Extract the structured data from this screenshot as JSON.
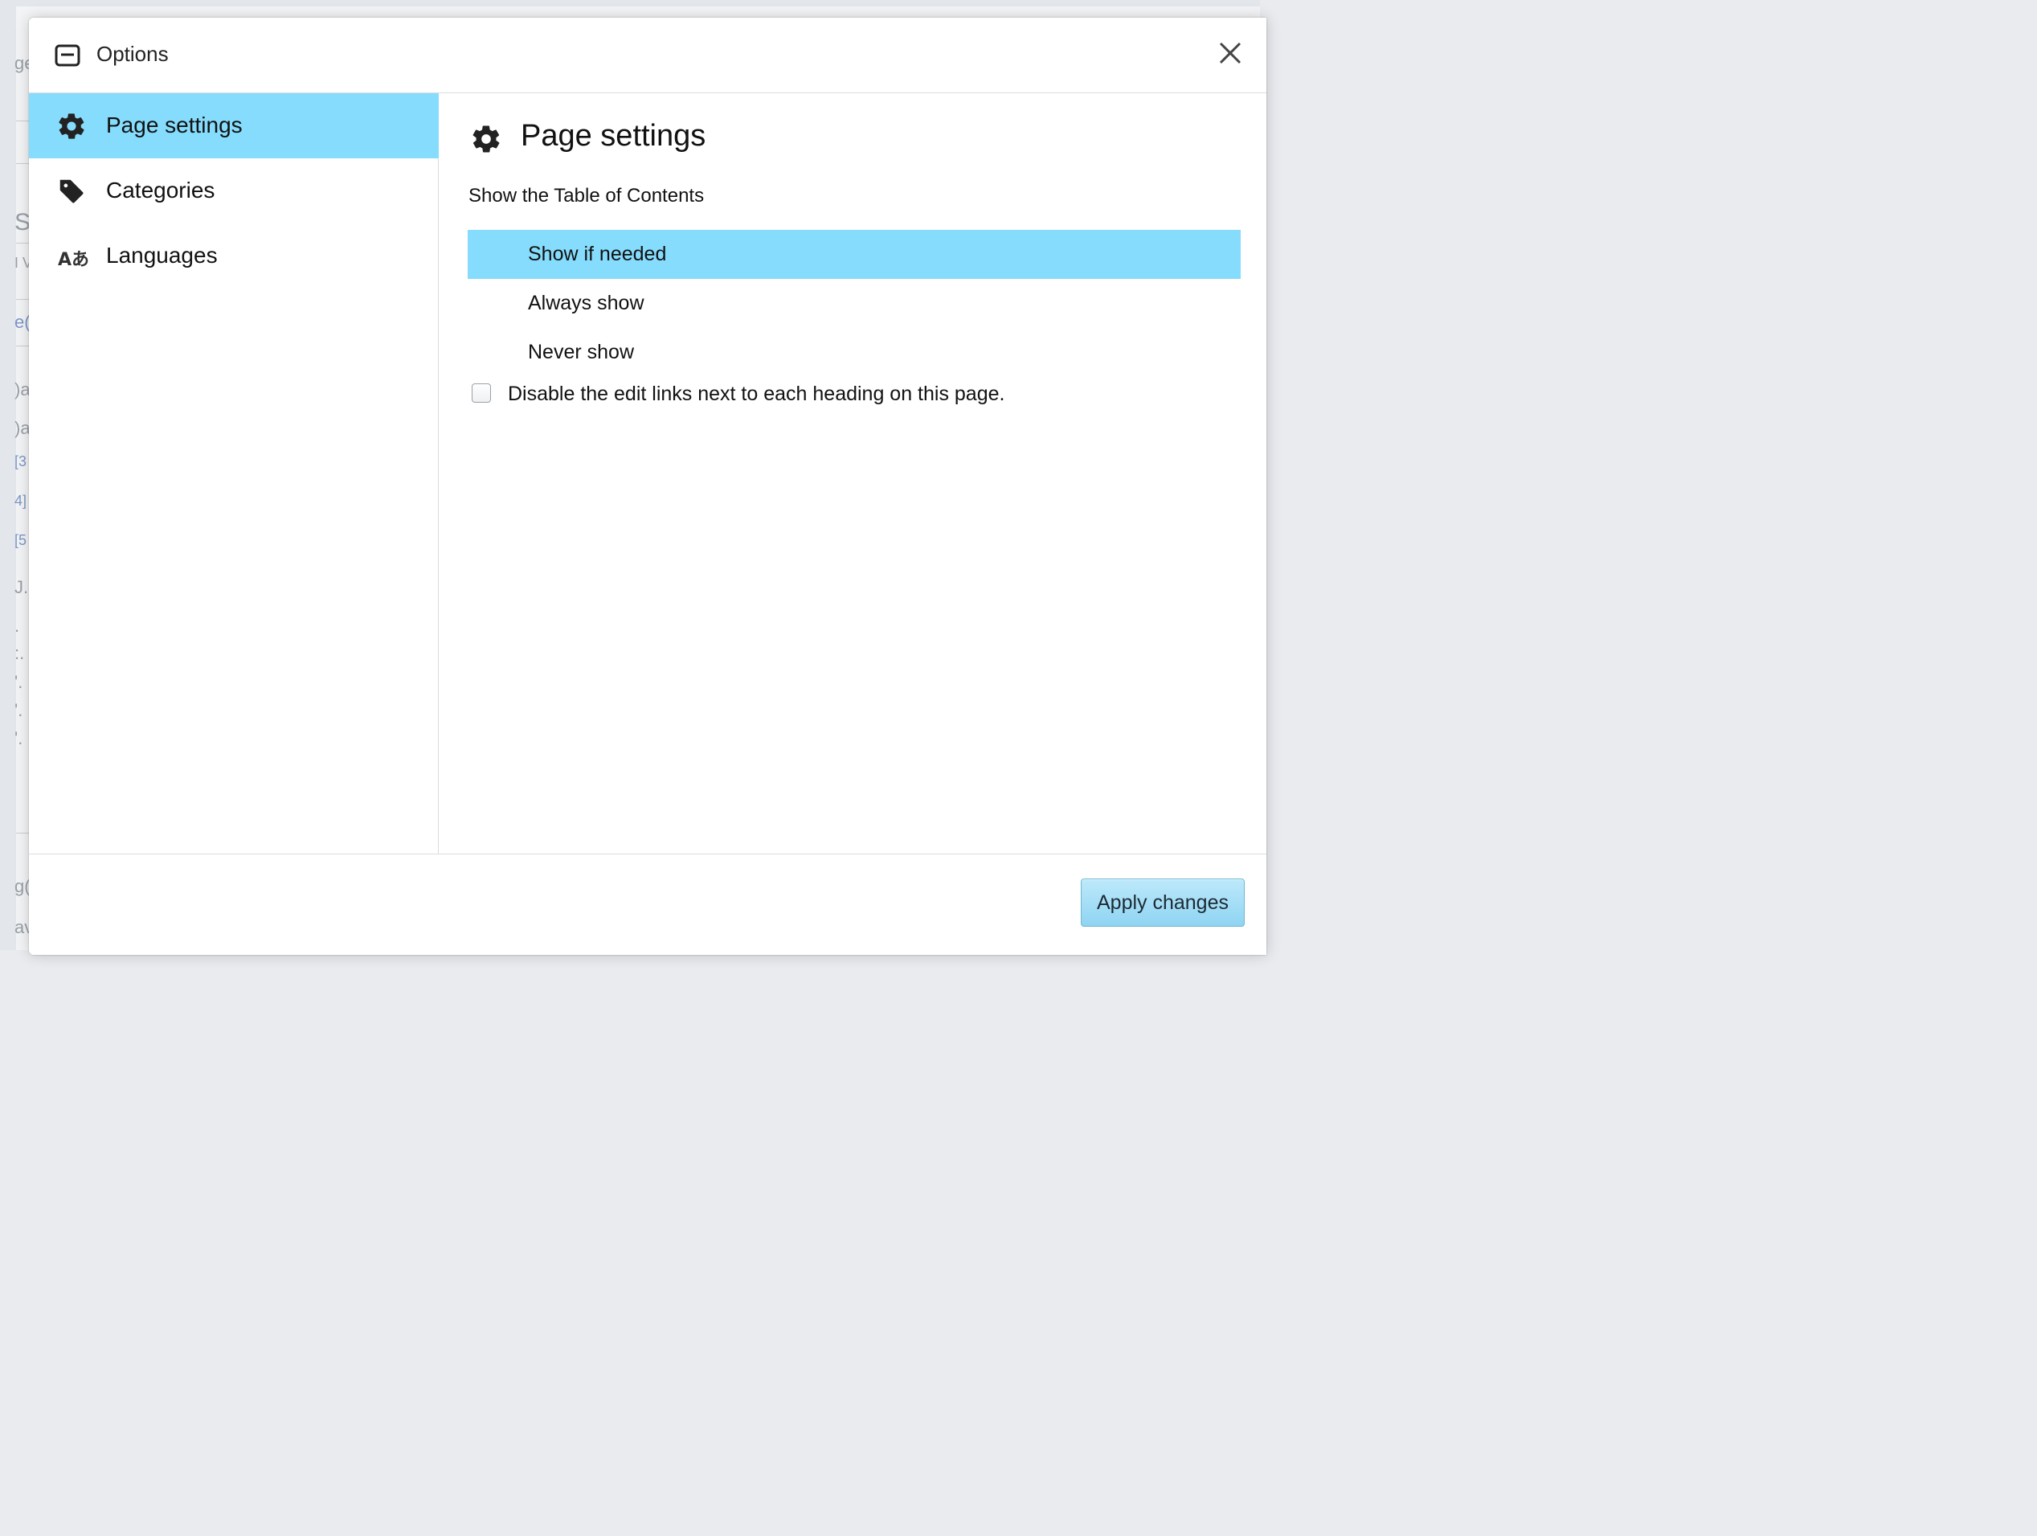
{
  "dialog": {
    "title": "Options",
    "close_label": "close"
  },
  "sidebar": {
    "items": [
      {
        "label": "Page settings",
        "icon": "gear-icon",
        "selected": true
      },
      {
        "label": "Categories",
        "icon": "tag-icon",
        "selected": false
      },
      {
        "label": "Languages",
        "icon": "language-icon",
        "icon_text": "Aあ",
        "selected": false
      }
    ]
  },
  "panel": {
    "title": "Page settings",
    "toc": {
      "label": "Show the Table of Contents",
      "options": [
        {
          "label": "Show if needed",
          "selected": true
        },
        {
          "label": "Always show",
          "selected": false
        },
        {
          "label": "Never show",
          "selected": false
        }
      ]
    },
    "disable_edit_links": {
      "label": "Disable the edit links next to each heading on this page.",
      "checked": false
    }
  },
  "footer": {
    "apply_label": "Apply changes"
  },
  "background_fragments": [
    "ge",
    "S(",
    "I V",
    "e(",
    ")a",
    ")a",
    "[3",
    "4]",
    "[5",
    "J.",
    ".",
    ":.",
    "'.",
    "'.",
    "'.",
    "g(",
    "av"
  ],
  "colors": {
    "selection": "#86dcfc",
    "button": "#8fd4f2",
    "border": "#d9dde2"
  }
}
